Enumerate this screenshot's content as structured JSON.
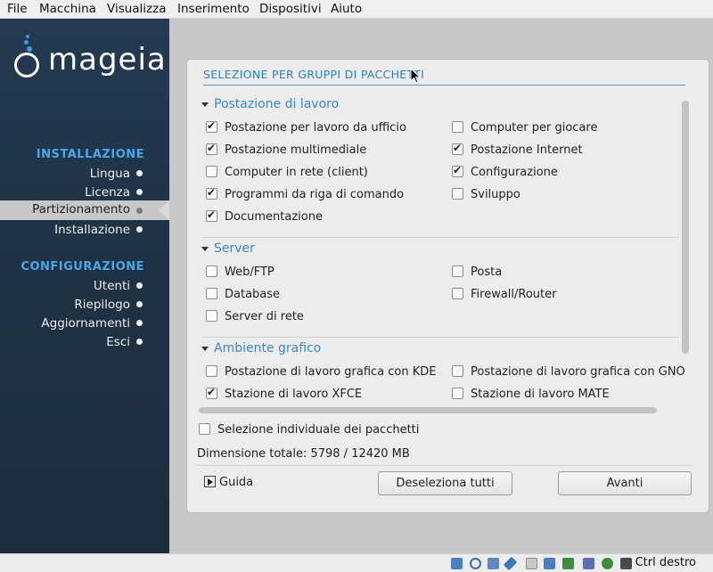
{
  "menubar": [
    "File",
    "Macchina",
    "Visualizza",
    "Inserimento",
    "Dispositivi",
    "Aiuto"
  ],
  "logo": {
    "text": "mageia"
  },
  "sidebar": {
    "install_title": "INSTALLAZIONE",
    "install_steps": [
      "Lingua",
      "Licenza",
      "Partizionamento",
      "Installazione"
    ],
    "config_title": "CONFIGURAZIONE",
    "config_steps": [
      "Utenti",
      "Riepilogo",
      "Aggiornamenti",
      "Esci"
    ],
    "active_step": "Partizionamento"
  },
  "panel": {
    "title": "SELEZIONE PER GRUPPI DI PACCHETTI",
    "groups": [
      {
        "name": "Postazione di lavoro",
        "left": [
          {
            "label": "Postazione per lavoro da ufficio",
            "checked": true
          },
          {
            "label": "Postazione multimediale",
            "checked": true
          },
          {
            "label": "Computer in rete (client)",
            "checked": false
          },
          {
            "label": "Programmi da riga di comando",
            "checked": true
          },
          {
            "label": "Documentazione",
            "checked": true
          }
        ],
        "right": [
          {
            "label": "Computer per giocare",
            "checked": false
          },
          {
            "label": "Postazione Internet",
            "checked": true
          },
          {
            "label": "Configurazione",
            "checked": true
          },
          {
            "label": "Sviluppo",
            "checked": false
          }
        ]
      },
      {
        "name": "Server",
        "left": [
          {
            "label": "Web/FTP",
            "checked": false
          },
          {
            "label": "Database",
            "checked": false
          },
          {
            "label": "Server di rete",
            "checked": false
          }
        ],
        "right": [
          {
            "label": "Posta",
            "checked": false
          },
          {
            "label": "Firewall/Router",
            "checked": false
          }
        ]
      },
      {
        "name": "Ambiente grafico",
        "left": [
          {
            "label": "Postazione di lavoro grafica con KDE",
            "checked": false
          },
          {
            "label": "Stazione di lavoro XFCE",
            "checked": true
          }
        ],
        "right": [
          {
            "label": "Postazione di lavoro grafica con GNO",
            "checked": false
          },
          {
            "label": "Stazione di lavoro MATE",
            "checked": false
          }
        ]
      }
    ],
    "individual_selection": {
      "label": "Selezione individuale dei pacchetti",
      "checked": false
    },
    "total_size": "Dimensione totale: 5798 / 12420 MB",
    "help_label": "Guida",
    "deselect_label": "Deseleziona tutti",
    "next_label": "Avanti"
  },
  "statusbar": {
    "host_key": "Ctrl destro",
    "icons": [
      "hdd-icon",
      "cd-icon",
      "usb-icon",
      "network-icon",
      "shared-folder-icon",
      "folder-icon",
      "display-icon",
      "video-capture-icon",
      "cpu-icon",
      "arrow-icon",
      "mouse-integration-icon"
    ]
  },
  "colors": {
    "accent": "#4aa8e6",
    "group_header": "#3a88c6",
    "sidebar_bg": "#1f3346"
  }
}
